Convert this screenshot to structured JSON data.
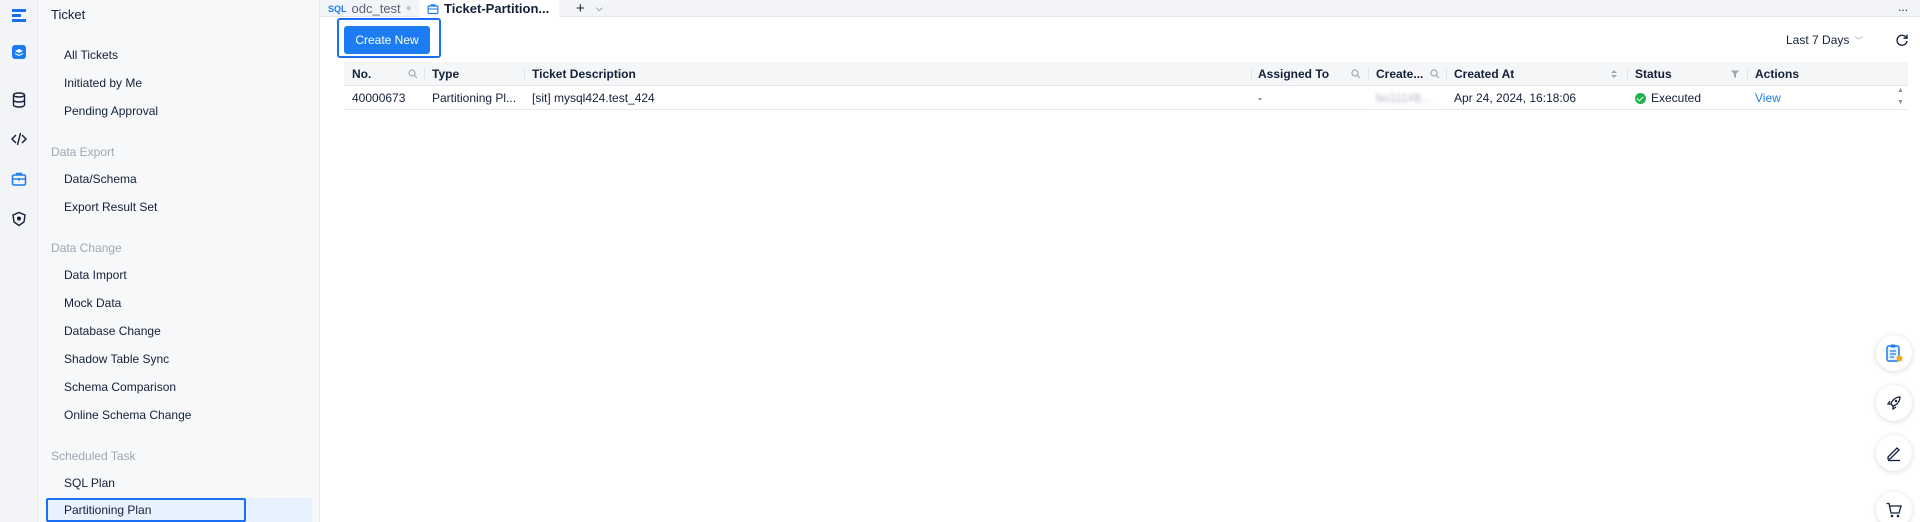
{
  "rail": {
    "icons": [
      "logo-icon",
      "workspace-icon",
      "database-icon",
      "code-icon",
      "ticket-icon",
      "security-icon"
    ]
  },
  "sidebar": {
    "title": "Ticket",
    "items": [
      {
        "label": "All Tickets"
      },
      {
        "label": "Initiated by Me"
      },
      {
        "label": "Pending Approval"
      }
    ],
    "groups": [
      {
        "label": "Data Export",
        "items": [
          {
            "label": "Data/Schema"
          },
          {
            "label": "Export Result Set"
          }
        ]
      },
      {
        "label": "Data Change",
        "items": [
          {
            "label": "Data Import"
          },
          {
            "label": "Mock Data"
          },
          {
            "label": "Database Change"
          },
          {
            "label": "Shadow Table Sync"
          },
          {
            "label": "Schema Comparison"
          },
          {
            "label": "Online Schema Change"
          }
        ]
      },
      {
        "label": "Scheduled Task",
        "items": [
          {
            "label": "SQL Plan"
          },
          {
            "label": "Partitioning Plan"
          }
        ]
      }
    ],
    "active_item": "Partitioning Plan"
  },
  "tabs": {
    "items": [
      {
        "prefix": "SQL",
        "label": "odc_test"
      },
      {
        "label": "Ticket-Partition..."
      }
    ],
    "add_label": "+",
    "more_label": "..."
  },
  "toolbar": {
    "create_label": "Create New",
    "range_label": "Last 7 Days"
  },
  "table": {
    "columns": [
      "No.",
      "Type",
      "Ticket Description",
      "Assigned To",
      "Create...",
      "Created At",
      "Status",
      "Actions"
    ],
    "rows": [
      {
        "no": "40000673",
        "type": "Partitioning Pl...",
        "description": "[sit] mysql424.test_424",
        "assigned_to": "-",
        "creator": "bo111#8...",
        "created_at": "Apr 24, 2024, 16:18:06",
        "status": "Executed",
        "action": "View"
      }
    ]
  },
  "colors": {
    "accent": "#1b7cf3",
    "focus_border": "#1b6ff5",
    "success": "#23b14d"
  }
}
